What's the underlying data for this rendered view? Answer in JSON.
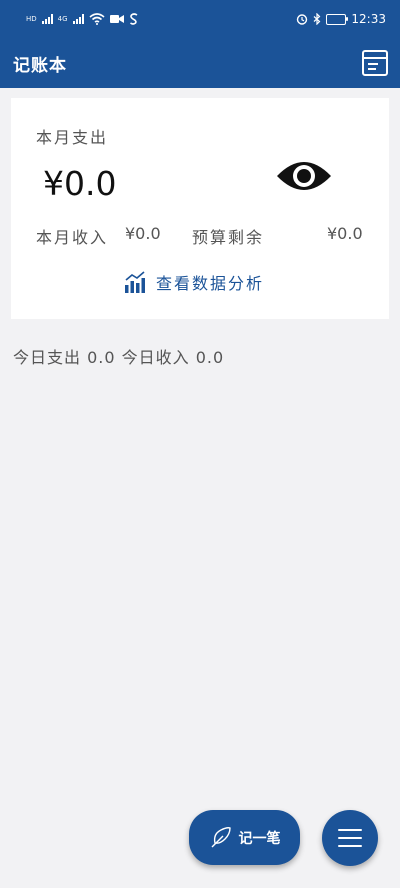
{
  "status_bar": {
    "signal_1_label": "HD",
    "signal_2_label": "4G",
    "time": "12:33",
    "battery_level": "0.85",
    "icons": [
      "signal-icon",
      "signal-icon",
      "wifi-icon",
      "video-icon",
      "app-notification-icon",
      "alarm-icon",
      "bluetooth-icon",
      "battery-icon"
    ]
  },
  "app_bar": {
    "title": "记账本",
    "action_icon": "bill-list-icon"
  },
  "summary_card": {
    "month_expense_label": "本月支出",
    "month_expense_value": "¥0.0",
    "visibility_icon": "eye-icon",
    "month_income_label": "本月收入",
    "month_income_value": "¥0.0",
    "budget_left_label": "预算剩余",
    "budget_left_value": "¥0.0",
    "analysis_link_label": "查看数据分析",
    "analysis_icon": "bar-chart-icon"
  },
  "today": {
    "text": "今日支出 0.0 今日收入 0.0"
  },
  "fab": {
    "record_label": "记一笔",
    "record_icon": "feather-icon",
    "menu_icon": "menu-icon"
  },
  "colors": {
    "primary": "#1b5398",
    "background": "#f2f2f4",
    "card": "#ffffff"
  }
}
